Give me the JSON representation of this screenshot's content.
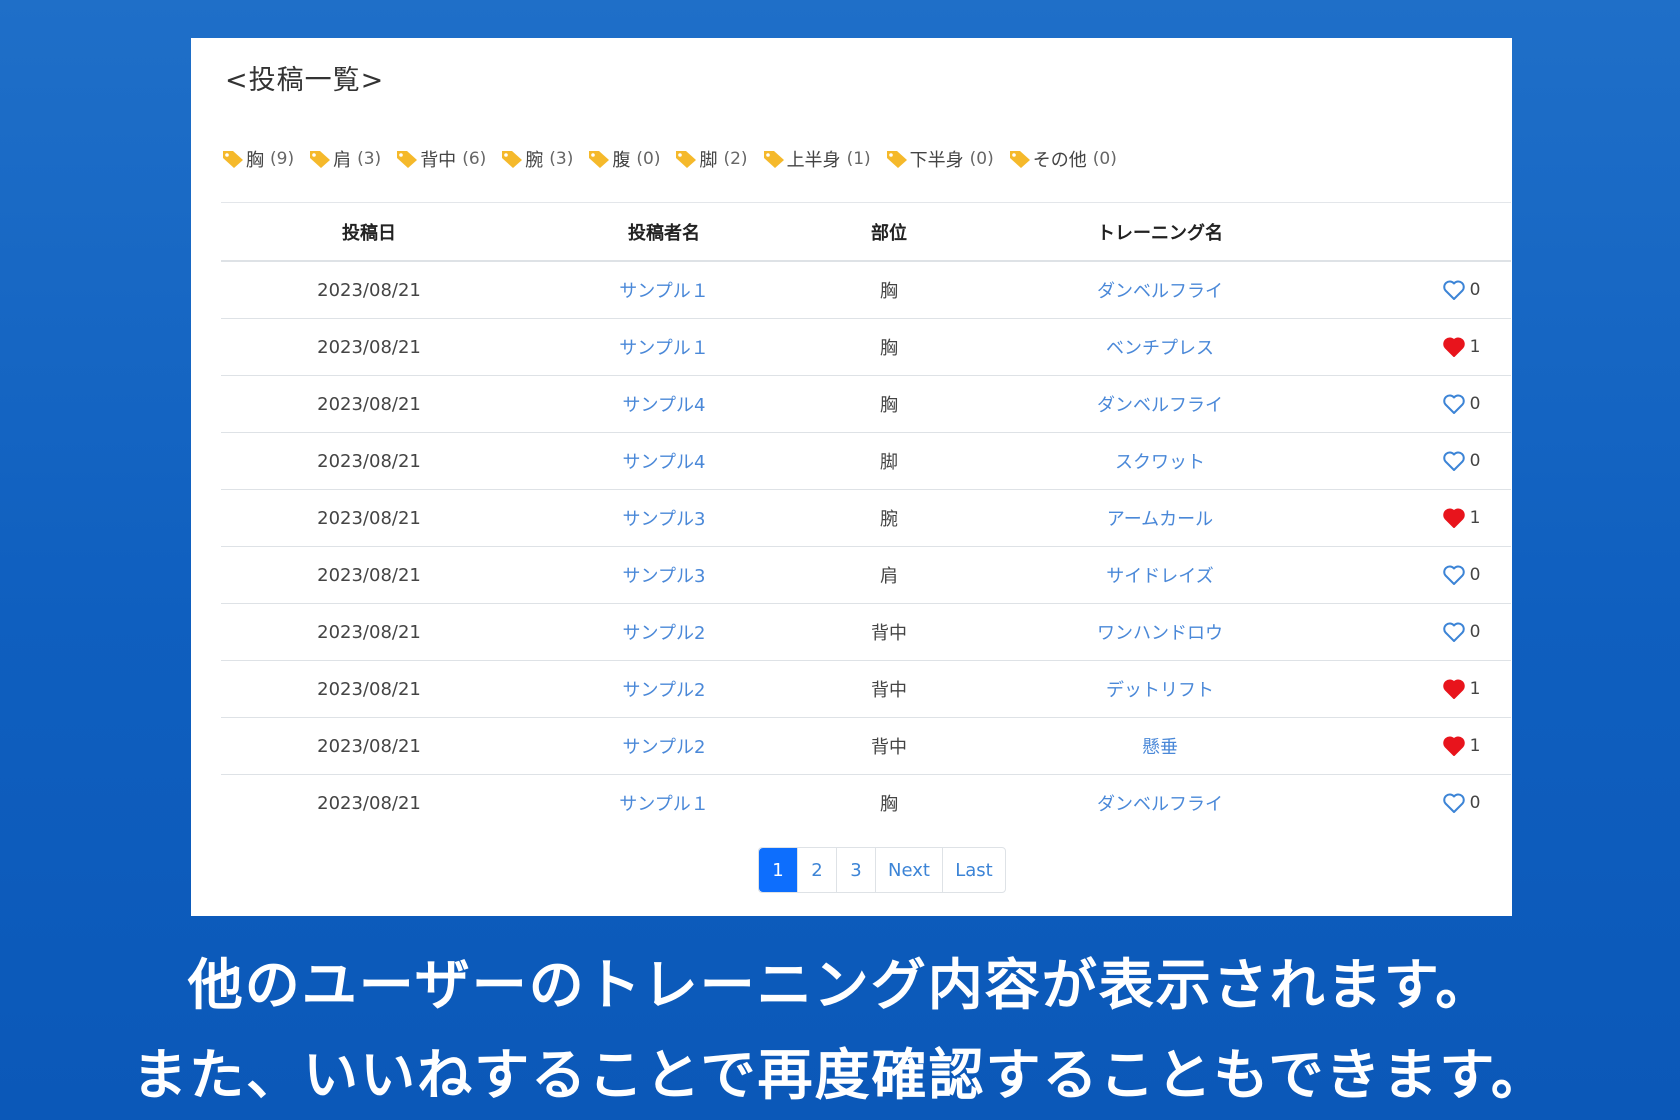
{
  "page_title": "<投稿一覧>",
  "tags": [
    {
      "label": "胸",
      "count": "(9)"
    },
    {
      "label": "肩",
      "count": "(3)"
    },
    {
      "label": "背中",
      "count": "(6)"
    },
    {
      "label": "腕",
      "count": "(3)"
    },
    {
      "label": "腹",
      "count": "(0)"
    },
    {
      "label": "脚",
      "count": "(2)"
    },
    {
      "label": "上半身",
      "count": "(1)"
    },
    {
      "label": "下半身",
      "count": "(0)"
    },
    {
      "label": "その他",
      "count": "(0)"
    }
  ],
  "table": {
    "headers": [
      "投稿日",
      "投稿者名",
      "部位",
      "トレーニング名",
      ""
    ],
    "rows": [
      {
        "date": "2023/08/21",
        "user": "サンプル１",
        "part": "胸",
        "training": "ダンベルフライ",
        "liked": false,
        "likes": "0"
      },
      {
        "date": "2023/08/21",
        "user": "サンプル１",
        "part": "胸",
        "training": "ベンチプレス",
        "liked": true,
        "likes": "1"
      },
      {
        "date": "2023/08/21",
        "user": "サンプル4",
        "part": "胸",
        "training": "ダンベルフライ",
        "liked": false,
        "likes": "0"
      },
      {
        "date": "2023/08/21",
        "user": "サンプル4",
        "part": "脚",
        "training": "スクワット",
        "liked": false,
        "likes": "0"
      },
      {
        "date": "2023/08/21",
        "user": "サンプル3",
        "part": "腕",
        "training": "アームカール",
        "liked": true,
        "likes": "1"
      },
      {
        "date": "2023/08/21",
        "user": "サンプル3",
        "part": "肩",
        "training": "サイドレイズ",
        "liked": false,
        "likes": "0"
      },
      {
        "date": "2023/08/21",
        "user": "サンプル2",
        "part": "背中",
        "training": "ワンハンドロウ",
        "liked": false,
        "likes": "0"
      },
      {
        "date": "2023/08/21",
        "user": "サンプル2",
        "part": "背中",
        "training": "デットリフト",
        "liked": true,
        "likes": "1"
      },
      {
        "date": "2023/08/21",
        "user": "サンプル2",
        "part": "背中",
        "training": "懸垂",
        "liked": true,
        "likes": "1"
      },
      {
        "date": "2023/08/21",
        "user": "サンプル１",
        "part": "胸",
        "training": "ダンベルフライ",
        "liked": false,
        "likes": "0"
      }
    ]
  },
  "pagination": {
    "pages": [
      "1",
      "2",
      "3"
    ],
    "current": "1",
    "next_label": "Next",
    "last_label": "Last"
  },
  "caption": {
    "line1": "他のユーザーのトレーニング内容が表示されます。",
    "line2": "また、いいねすることで再度確認することもできます。"
  },
  "colors": {
    "background": "#1466c4",
    "link": "#4a88d8",
    "tag_icon": "#f5b92b",
    "heart_filled": "#e8141c",
    "heart_outline": "#3c84d6",
    "active_page": "#0d6efd"
  },
  "icons": {
    "tag": "tag-icon",
    "like_empty": "heart-outline-icon",
    "like_filled": "heart-filled-icon"
  }
}
